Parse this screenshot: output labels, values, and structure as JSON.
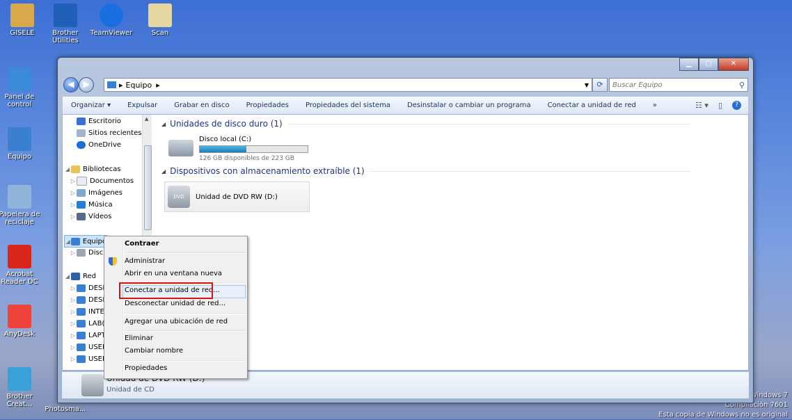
{
  "desktop": {
    "icons_top": [
      {
        "label": "GISELE",
        "color": "#d9a84a"
      },
      {
        "label": "Brother Utilities",
        "color": "#1f5fb8"
      },
      {
        "label": "TeamViewer",
        "color": "#1a6fe0"
      },
      {
        "label": "Scan",
        "color": "#e6d6a0"
      }
    ],
    "icons_left": [
      {
        "label": "Panel de control",
        "color": "#3b8ad8"
      },
      {
        "label": "Equipo",
        "color": "#3a7fd0"
      },
      {
        "label": "Papelera de reciclaje",
        "color": "#8fb4d8"
      },
      {
        "label": "Acrobat Reader DC",
        "color": "#d9261c"
      },
      {
        "label": "AnyDesk",
        "color": "#ef443b"
      },
      {
        "label": "Brother Creat...",
        "color": "#3aa0d8"
      }
    ],
    "taskbar_partial": "Photosma...",
    "watermark": {
      "line1": "Windows 7",
      "line2": "Compilación 7601",
      "line3": "Esta copia de Windows no es original"
    }
  },
  "window": {
    "address": {
      "computer_label": "Equipo"
    },
    "search_placeholder": "Buscar Equipo",
    "toolbar": [
      "Organizar ▾",
      "Expulsar",
      "Grabar en disco",
      "Propiedades",
      "Propiedades del sistema",
      "Desinstalar o cambiar un programa",
      "Conectar a unidad de red",
      "»"
    ],
    "nav": {
      "favorites": [
        "Escritorio",
        "Sitios recientes",
        "OneDrive"
      ],
      "libraries_label": "Bibliotecas",
      "libraries": [
        "Documentos",
        "Imágenes",
        "Música",
        "Vídeos"
      ],
      "computer_label": "Equipo",
      "computer_child": "Disc",
      "network_label": "Red",
      "network": [
        "DESI",
        "DESI",
        "INTE",
        "LAB(",
        "LAPT",
        "USEF",
        "USEF"
      ]
    },
    "groups": {
      "hdd_header": "Unidades de disco duro (1)",
      "hdd_name": "Disco local (C:)",
      "hdd_free": "126 GB disponibles de 223 GB",
      "hdd_used_fraction": 0.435,
      "removable_header": "Dispositivos con almacenamiento extraíble (1)",
      "dvd_name": "Unidad de DVD RW (D:)"
    },
    "details": {
      "name": "Unidad de DVD RW (D:)",
      "type": "Unidad de CD"
    }
  },
  "context_menu": {
    "items": [
      "Contraer",
      "Administrar",
      "Abrir en una ventana nueva",
      "Conectar a unidad de red...",
      "Desconectar unidad de red...",
      "Agregar una ubicación de red",
      "Eliminar",
      "Cambiar nombre",
      "Propiedades"
    ]
  }
}
